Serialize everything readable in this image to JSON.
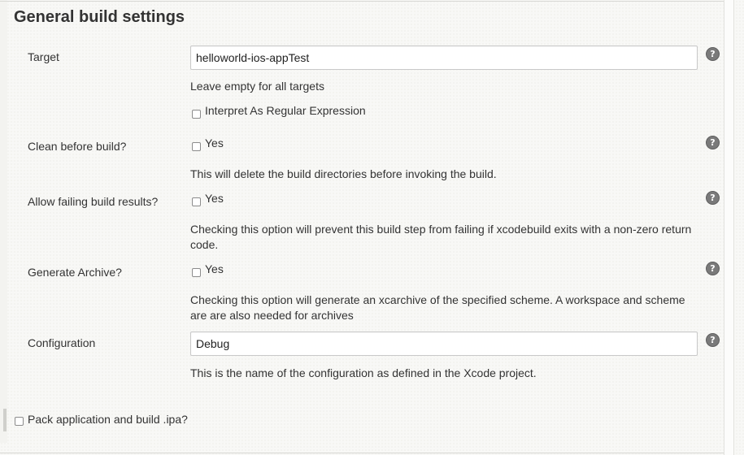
{
  "section": {
    "title": "General build settings"
  },
  "fields": {
    "target": {
      "label": "Target",
      "value": "helloworld-ios-appTest",
      "help": "Leave empty for all targets",
      "regex_label": "Interpret As Regular Expression",
      "regex_checked": false
    },
    "clean": {
      "label": "Clean before build?",
      "option_label": "Yes",
      "checked": false,
      "help": "This will delete the build directories before invoking the build."
    },
    "allow_failing": {
      "label": "Allow failing build results?",
      "option_label": "Yes",
      "checked": false,
      "help": "Checking this option will prevent this build step from failing if xcodebuild exits with a non-zero return code."
    },
    "archive": {
      "label": "Generate Archive?",
      "option_label": "Yes",
      "checked": false,
      "help": "Checking this option will generate an xcarchive of the specified scheme. A workspace and scheme are are also needed for archives"
    },
    "configuration": {
      "label": "Configuration",
      "value": "Debug",
      "help": "This is the name of the configuration as defined in the Xcode project."
    }
  },
  "pack": {
    "label": "Pack application and build .ipa?",
    "checked": false
  },
  "help_icon": {
    "glyph": "?",
    "icon": "help-icon"
  }
}
